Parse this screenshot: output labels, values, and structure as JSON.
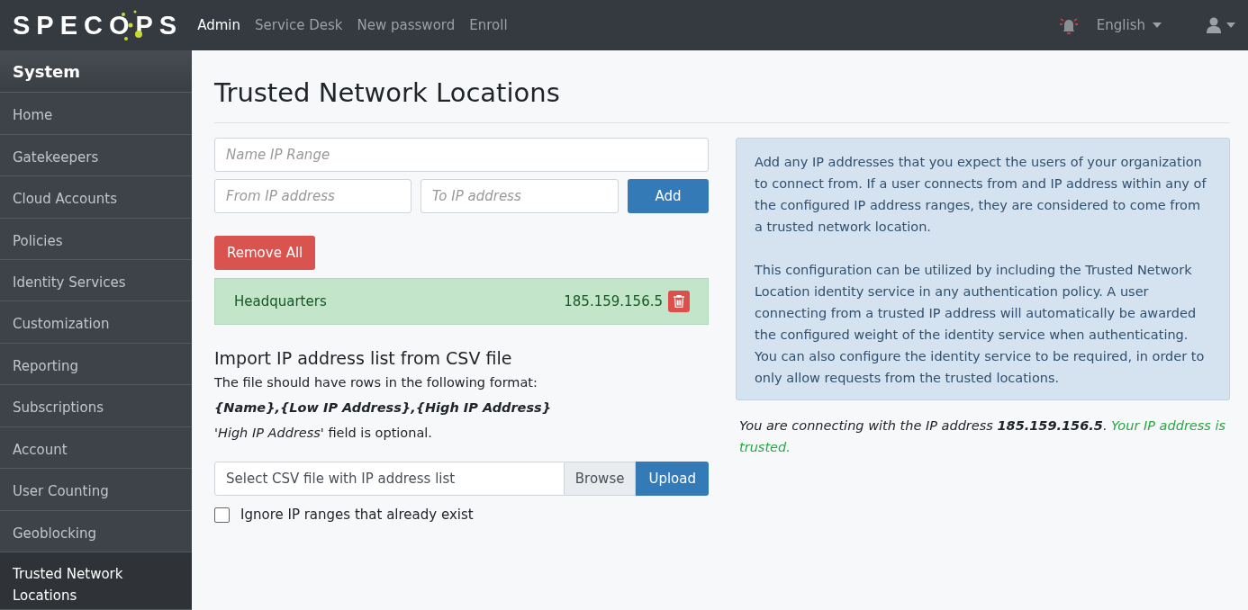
{
  "navbar": {
    "logo": "SPECOPS",
    "links": [
      {
        "label": "Admin",
        "selected": true
      },
      {
        "label": "Service Desk",
        "selected": false
      },
      {
        "label": "New password",
        "selected": false
      },
      {
        "label": "Enroll",
        "selected": false
      }
    ],
    "language": "English"
  },
  "sidebar": {
    "title": "System",
    "items": [
      {
        "label": "Home",
        "selected": false
      },
      {
        "label": "Gatekeepers",
        "selected": false
      },
      {
        "label": "Cloud Accounts",
        "selected": false
      },
      {
        "label": "Policies",
        "selected": false
      },
      {
        "label": "Identity Services",
        "selected": false
      },
      {
        "label": "Customization",
        "selected": false
      },
      {
        "label": "Reporting",
        "selected": false
      },
      {
        "label": "Subscriptions",
        "selected": false
      },
      {
        "label": "Account",
        "selected": false
      },
      {
        "label": "User Counting",
        "selected": false
      },
      {
        "label": "Geoblocking",
        "selected": false
      },
      {
        "label": "Trusted Network Locations",
        "selected": true
      }
    ]
  },
  "page": {
    "title": "Trusted Network Locations",
    "form": {
      "name_placeholder": "Name IP Range",
      "from_placeholder": "From IP address",
      "to_placeholder": "To IP address",
      "add_button": "Add",
      "remove_all_button": "Remove All"
    },
    "locations": [
      {
        "name": "Headquarters",
        "ip": "185.159.156.5"
      }
    ],
    "import": {
      "heading": "Import IP address list from CSV file",
      "intro": "The file should have rows in the following format:",
      "format": "{Name},{Low IP Address},{High IP Address}",
      "note": "*'High IP Address'* field is optional.",
      "file_placeholder": "Select CSV file with IP address list",
      "browse_label": "Browse",
      "upload_button": "Upload",
      "ignore_label": "Ignore IP ranges that already exist",
      "ignore_checked": false
    },
    "info": [
      "Add any IP addresses that you expect the users of your organization to connect from. If a user connects from and IP address within any of the configured IP address ranges, they are considered to come from a trusted network location.",
      "This configuration can be utilized by including the Trusted Network Location identity service in any authentication policy. A user connecting from a trusted IP address will automatically be awarded the configured weight of the identity service when authenticating. You can also configure the identity service to be required, in order to only allow requests from the trusted locations."
    ],
    "status": {
      "text": "You are connecting with the IP address **185.159.156.5**.",
      "trusted_text": "Your IP address is trusted."
    }
  }
}
